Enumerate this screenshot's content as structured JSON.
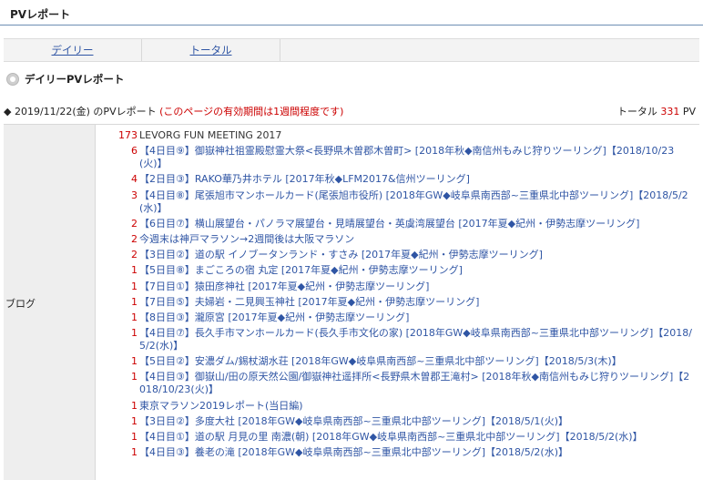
{
  "header": {
    "title": "PVレポート"
  },
  "tabs": [
    {
      "label": "デイリー"
    },
    {
      "label": "トータル"
    }
  ],
  "section": {
    "label": "デイリーPVレポート"
  },
  "report": {
    "date_prefix": "◆ 2019/11/22(金) のPVレポート",
    "notice": "(このページの有効期間は1週間程度です)",
    "total_label": "トータル",
    "total_value": "331",
    "total_unit": "PV"
  },
  "table": {
    "category": "ブログ",
    "rows": [
      {
        "count": "173",
        "title": "LEVORG FUN MEETING 2017"
      },
      {
        "count": "6",
        "title": "【4日目⑨】御嶽神社祖霊殿慰霊大祭<長野県木曽郡木曽町> [2018年秋◆南信州もみじ狩りツーリング]【2018/10/23(火)】"
      },
      {
        "count": "4",
        "title": "【2日目③】RAKO華乃井ホテル [2017年秋◆LFM2017&信州ツーリング]"
      },
      {
        "count": "3",
        "title": "【4日目⑧】尾張旭市マンホールカード(尾張旭市役所) [2018年GW◆岐阜県南西部~三重県北中部ツーリング]【2018/5/2(水)】"
      },
      {
        "count": "2",
        "title": "【6日目⑦】横山展望台・パノラマ展望台・見晴展望台・英虞湾展望台 [2017年夏◆紀州・伊勢志摩ツーリング]"
      },
      {
        "count": "2",
        "title": "今週末は神戸マラソン→2週間後は大阪マラソン"
      },
      {
        "count": "2",
        "title": "【3日目②】道の駅 イノブータンランド・すさみ [2017年夏◆紀州・伊勢志摩ツーリング]"
      },
      {
        "count": "1",
        "title": "【5日目⑧】まごころの宿 丸定 [2017年夏◆紀州・伊勢志摩ツーリング]"
      },
      {
        "count": "1",
        "title": "【7日目①】猿田彦神社 [2017年夏◆紀州・伊勢志摩ツーリング]"
      },
      {
        "count": "1",
        "title": "【7日目⑤】夫婦岩・二見興玉神社 [2017年夏◆紀州・伊勢志摩ツーリング]"
      },
      {
        "count": "1",
        "title": "【8日目③】瀧原宮 [2017年夏◆紀州・伊勢志摩ツーリング]"
      },
      {
        "count": "1",
        "title": "【4日目⑦】長久手市マンホールカード(長久手市文化の家) [2018年GW◆岐阜県南西部~三重県北中部ツーリング]【2018/5/2(水)】"
      },
      {
        "count": "1",
        "title": "【5日目②】安濃ダム/錫杖湖水荘 [2018年GW◆岐阜県南西部~三重県北中部ツーリング]【2018/5/3(木)】"
      },
      {
        "count": "1",
        "title": "【4日目③】御嶽山/田の原天然公園/御嶽神社遥拝所<長野県木曽郡王滝村> [2018年秋◆南信州もみじ狩りツーリング]【2018/10/23(火)】"
      },
      {
        "count": "1",
        "title": "東京マラソン2019レポート(当日編)"
      },
      {
        "count": "1",
        "title": "【3日目②】多度大社 [2018年GW◆岐阜県南西部~三重県北中部ツーリング]【2018/5/1(火)】"
      },
      {
        "count": "1",
        "title": "【4日目①】道の駅 月見の里 南濃(朝) [2018年GW◆岐阜県南西部~三重県北中部ツーリング]【2018/5/2(水)】"
      },
      {
        "count": "1",
        "title": "【4日目③】養老の滝 [2018年GW◆岐阜県南西部~三重県北中部ツーリング]【2018/5/2(水)】"
      }
    ]
  }
}
